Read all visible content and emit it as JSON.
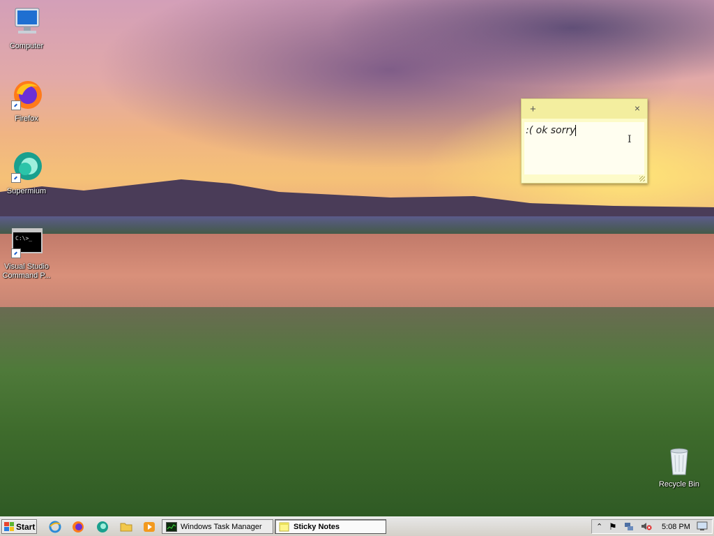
{
  "desktop": {
    "icons": [
      {
        "label": "Computer",
        "icon": "computer-icon"
      },
      {
        "label": "Firefox",
        "icon": "firefox-icon"
      },
      {
        "label": "Supermium",
        "icon": "supermium-icon"
      },
      {
        "label": "Visual Studio Command P...",
        "icon": "command-prompt-icon"
      },
      {
        "label": "Recycle Bin",
        "icon": "recycle-bin-icon"
      }
    ]
  },
  "sticky_note": {
    "add_symbol": "+",
    "close_symbol": "×",
    "text": ":( ok sorry",
    "color": "#fdfbc9"
  },
  "taskbar": {
    "start_label": "Start",
    "quick_launch": [
      "ie-icon",
      "firefox-icon",
      "supermium-icon",
      "folder-icon",
      "media-player-icon"
    ],
    "tasks": [
      {
        "label": "Windows Task Manager",
        "active": false
      },
      {
        "label": "Sticky Notes",
        "active": true
      }
    ],
    "tray": {
      "icons": [
        "chevron-up-icon",
        "action-center-flag-icon",
        "network-icon",
        "volume-muted-icon"
      ],
      "time": "5:08 PM"
    }
  }
}
